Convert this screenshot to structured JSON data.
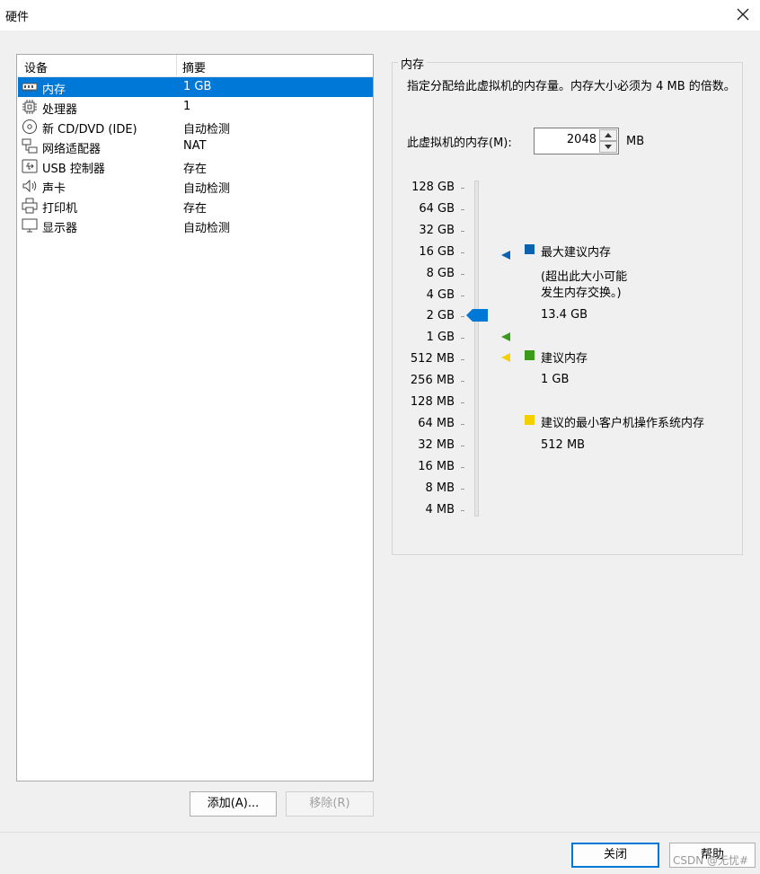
{
  "window": {
    "title": "硬件"
  },
  "devices": {
    "col_device": "设备",
    "col_summary": "摘要",
    "rows": [
      {
        "name": "内存",
        "summary": "1 GB",
        "icon": "memory-icon"
      },
      {
        "name": "处理器",
        "summary": "1",
        "icon": "cpu-icon"
      },
      {
        "name": "新 CD/DVD (IDE)",
        "summary": "自动检测",
        "icon": "cd-icon"
      },
      {
        "name": "网络适配器",
        "summary": "NAT",
        "icon": "network-icon"
      },
      {
        "name": "USB 控制器",
        "summary": "存在",
        "icon": "usb-icon"
      },
      {
        "name": "声卡",
        "summary": "自动检测",
        "icon": "speaker-icon"
      },
      {
        "name": "打印机",
        "summary": "存在",
        "icon": "printer-icon"
      },
      {
        "name": "显示器",
        "summary": "自动检测",
        "icon": "monitor-icon"
      }
    ],
    "selected_index": 0,
    "add_label": "添加(A)...",
    "remove_label": "移除(R)"
  },
  "memory": {
    "group_title": "内存",
    "description": "指定分配给此虚拟机的内存量。内存大小必须为 4 MB 的倍数。",
    "field_label": "此虚拟机的内存(M):",
    "value": "2048",
    "unit": "MB",
    "scale": [
      "128 GB",
      "64 GB",
      "32 GB",
      "16 GB",
      "8 GB",
      "4 GB",
      "2 GB",
      "1 GB",
      "512 MB",
      "256 MB",
      "128 MB",
      "64 MB",
      "32 MB",
      "16 MB",
      "8 MB",
      "4 MB"
    ],
    "current_scale_label": "2 GB",
    "max_recommended": {
      "title": "最大建议内存",
      "note_line1": "(超出此大小可能",
      "note_line2": "发生内存交换。)",
      "value": "13.4 GB",
      "color": "#0a62b0"
    },
    "recommended": {
      "title": "建议内存",
      "value": "1 GB",
      "color": "#3a9a1a"
    },
    "guest_min": {
      "title": "建议的最小客户机操作系统内存",
      "value": "512 MB",
      "color": "#f5d000"
    },
    "accent_color": "#0078d7"
  },
  "footer": {
    "close_label": "关闭",
    "help_label": "帮助",
    "watermark": "CSDN @无忧#"
  }
}
